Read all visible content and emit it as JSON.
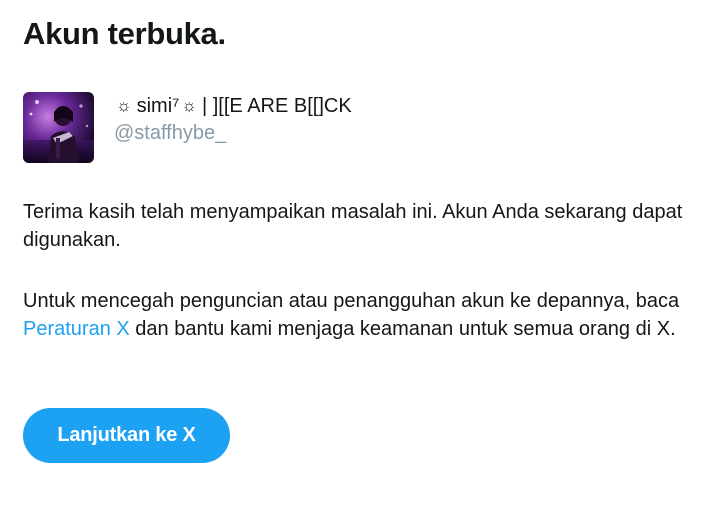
{
  "page": {
    "title": "Akun terbuka."
  },
  "account": {
    "sun_symbol": "☼",
    "name_part_1": "simi⁷",
    "name_part_2": "| ][[E ARE B[[]CK",
    "username": "@staffhybe_",
    "avatar_icon": "profile-photo"
  },
  "message": {
    "paragraph_1": "Terima kasih telah menyampaikan masalah ini. Akun Anda sekarang dapat digunakan.",
    "paragraph_2_before": "Untuk mencegah penguncian atau penangguhan akun ke depannya, baca ",
    "rules_link": "Peraturan X",
    "paragraph_2_after": " dan bantu kami menjaga keamanan untuk semua orang di X."
  },
  "actions": {
    "continue_label": "Lanjutkan ke X"
  },
  "colors": {
    "accent": "#1da1f2",
    "text": "#14171a",
    "muted": "#8899a6",
    "background": "#ffffff"
  }
}
